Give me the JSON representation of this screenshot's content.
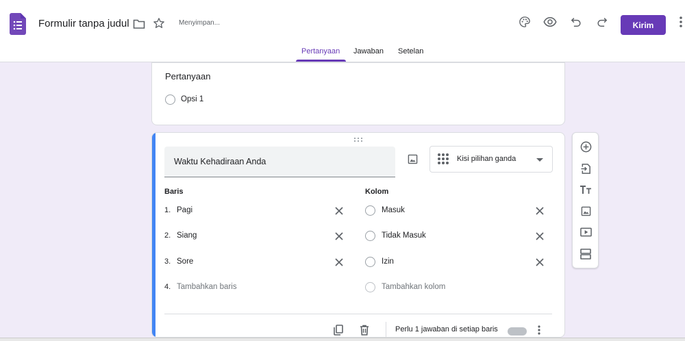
{
  "header": {
    "form_title": "Formulir tanpa judul",
    "saving_status": "Menyimpan...",
    "send_label": "Kirim",
    "icons": [
      "forms-app-icon",
      "folder-icon",
      "star-icon",
      "palette-icon",
      "eye-icon",
      "undo-icon",
      "redo-icon",
      "more-vert-icon"
    ],
    "accent_color": "#673ab7"
  },
  "tabs": [
    {
      "label": "Pertanyaan",
      "active": true
    },
    {
      "label": "Jawaban",
      "active": false
    },
    {
      "label": "Setelan",
      "active": false
    }
  ],
  "prev_question": {
    "title": "Pertanyaan",
    "option": "Opsi 1"
  },
  "question": {
    "title": "Waktu Kehadiraan Anda",
    "type": "Kisi pilihan ganda",
    "rows_heading": "Baris",
    "columns_heading": "Kolom",
    "rows": [
      {
        "num": "1.",
        "label": "Pagi"
      },
      {
        "num": "2.",
        "label": "Siang"
      },
      {
        "num": "3.",
        "label": "Sore"
      }
    ],
    "add_row": {
      "num": "4.",
      "label": "Tambahkan baris"
    },
    "columns": [
      "Masuk",
      "Tidak Masuk",
      "Izin"
    ],
    "add_column": "Tambahkan kolom",
    "required_text": "Perlu 1 jawaban di setiap baris",
    "accent_color": "#4285f4"
  },
  "side_toolbar": [
    "add-question-icon",
    "import-question-icon",
    "add-title-icon",
    "add-image-icon",
    "add-video-icon",
    "add-section-icon"
  ]
}
